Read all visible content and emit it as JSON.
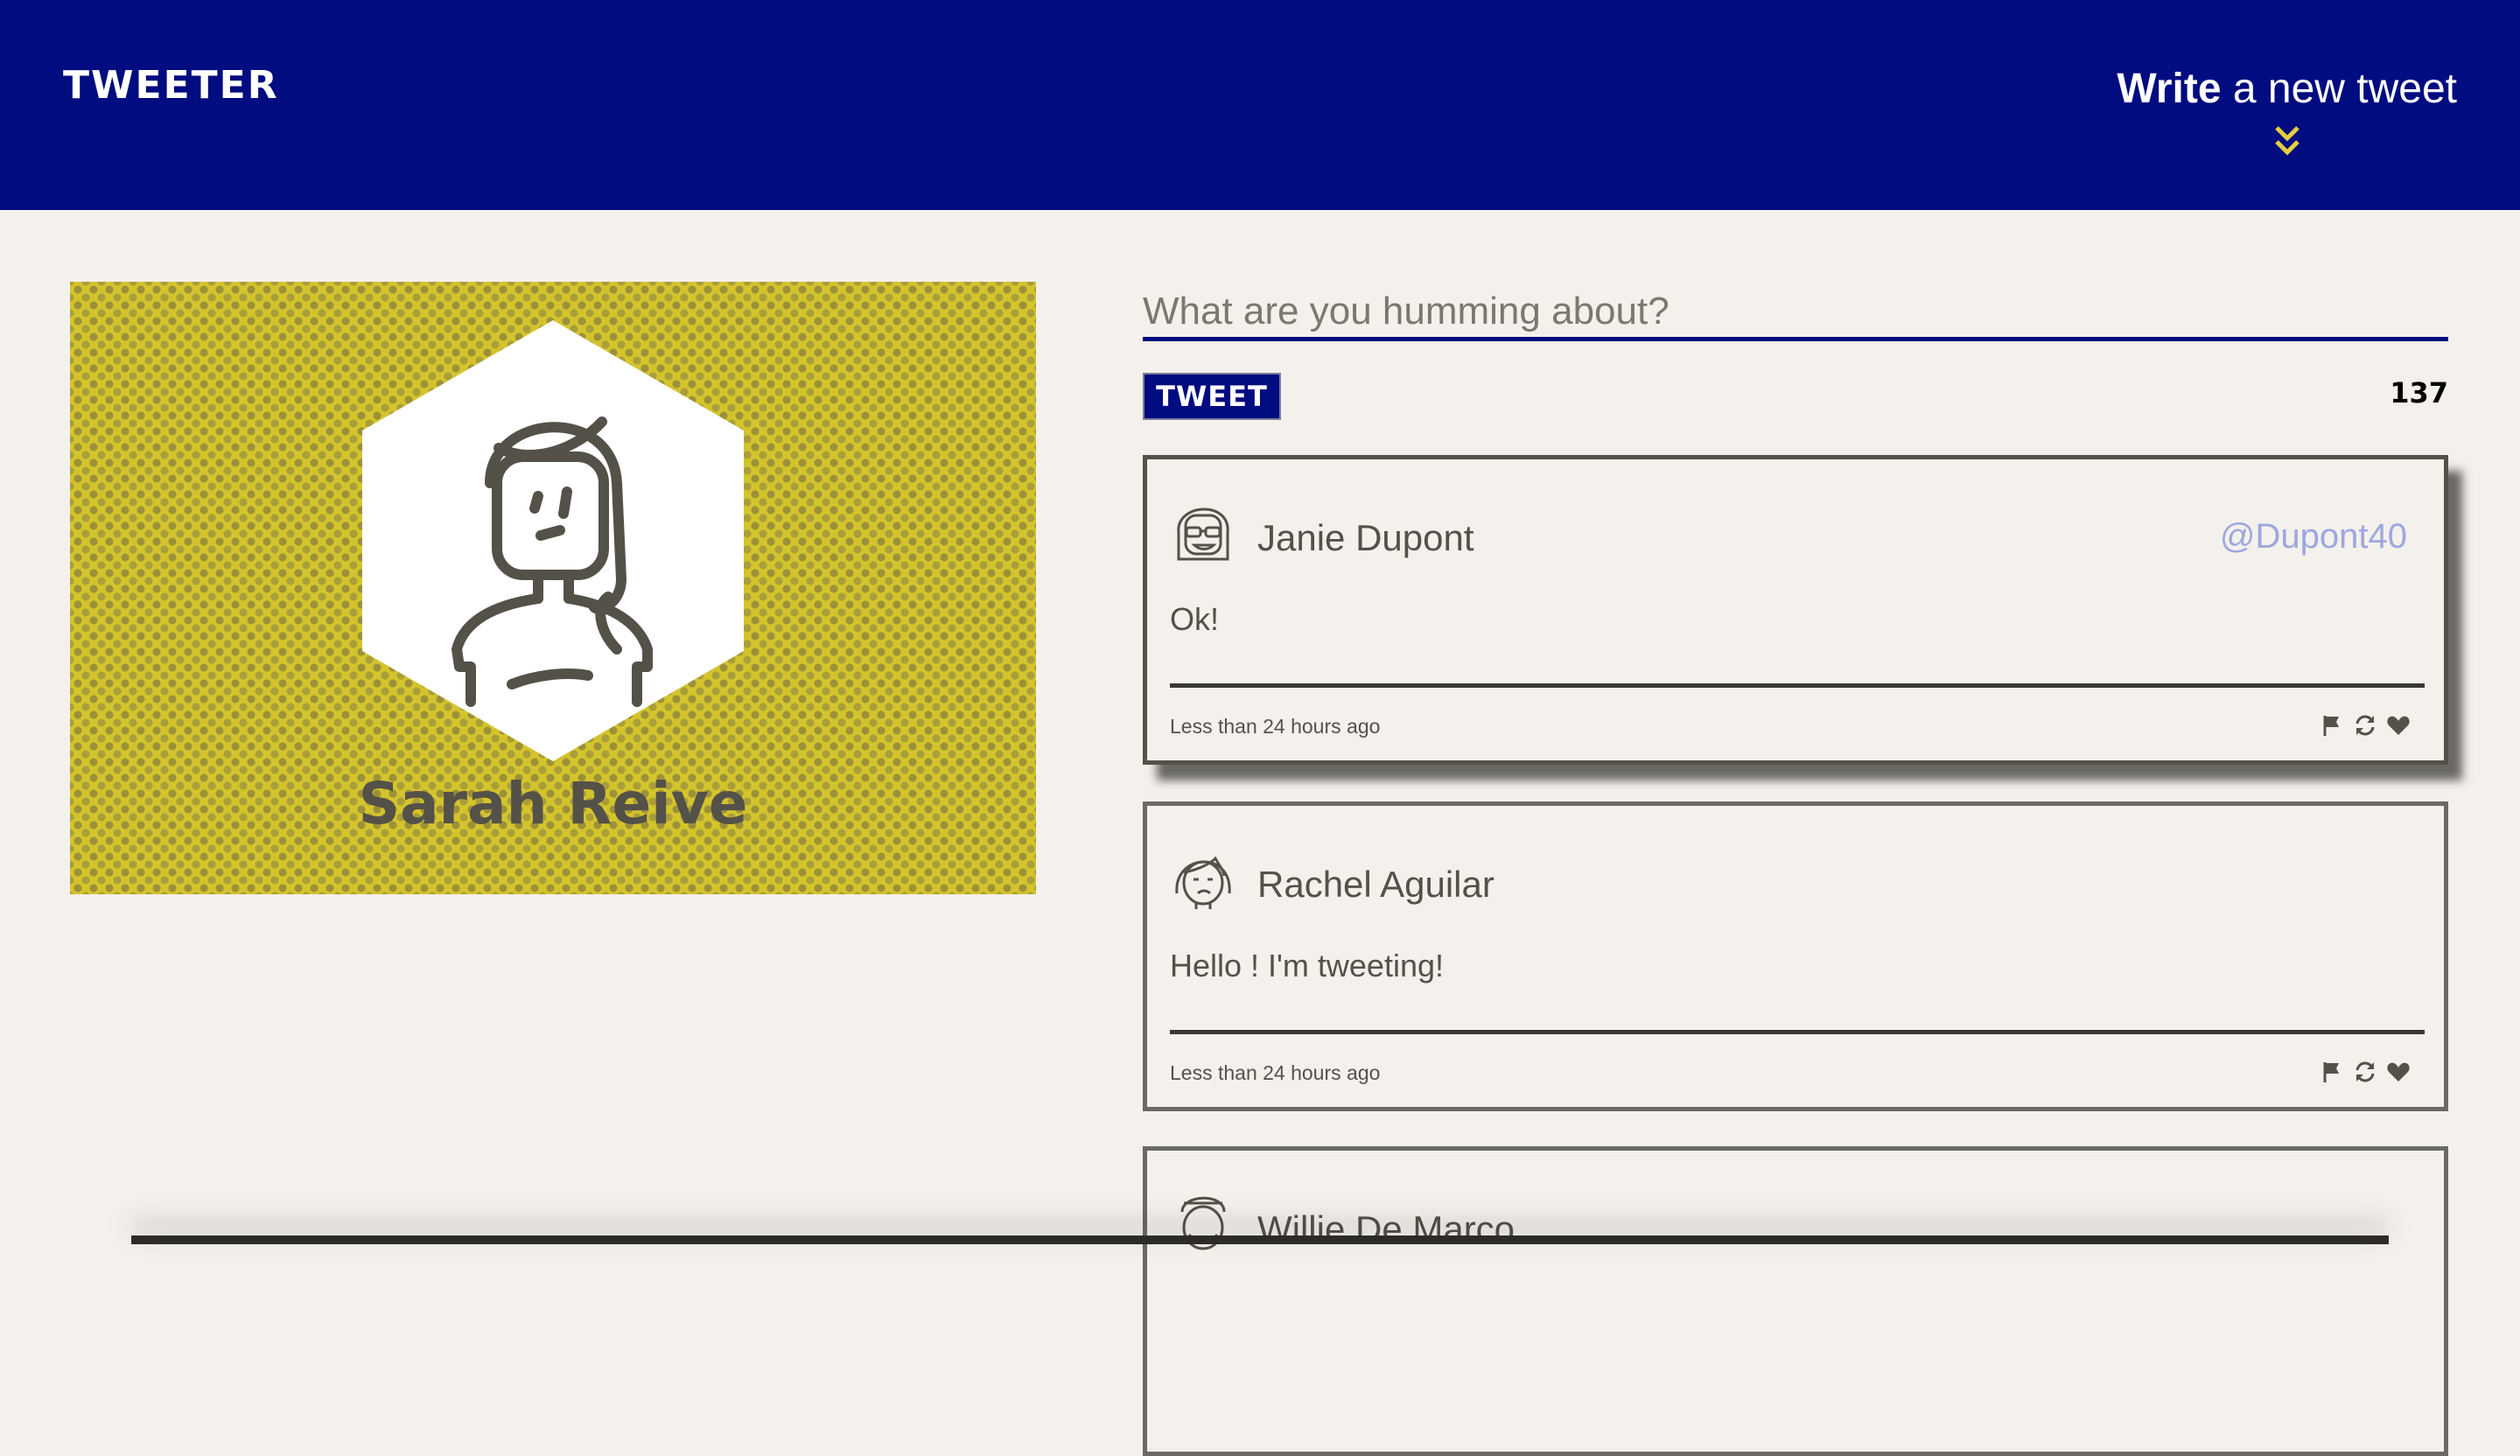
{
  "nav": {
    "logo": "TWEETER",
    "compose_bold": "Write",
    "compose_rest": " a new tweet"
  },
  "profile": {
    "name": "Sarah Reive"
  },
  "composer": {
    "placeholder": "What are you humming about?",
    "button_label": "TWEET",
    "char_counter": "137"
  },
  "tweets": [
    {
      "name": "Janie Dupont",
      "handle": "@Dupont40",
      "text": "Ok!",
      "time": "Less than 24 hours ago"
    },
    {
      "name": "Rachel Aguilar",
      "handle": "",
      "text": "Hello ! I'm tweeting!",
      "time": "Less than 24 hours ago"
    },
    {
      "name": "Willie De Marco",
      "handle": "",
      "text": "",
      "time": ""
    }
  ],
  "colors": {
    "nav_bg": "#000c7f",
    "page_bg": "#f4f1ec",
    "accent_yellow": "#d4c42c",
    "handle_blue": "#9ea7df",
    "text": "#545149"
  },
  "icons": {
    "flag": "flag-icon",
    "retweet": "retweet-icon",
    "like": "heart-icon",
    "compose_toggle": "double-chevron-down-icon"
  }
}
